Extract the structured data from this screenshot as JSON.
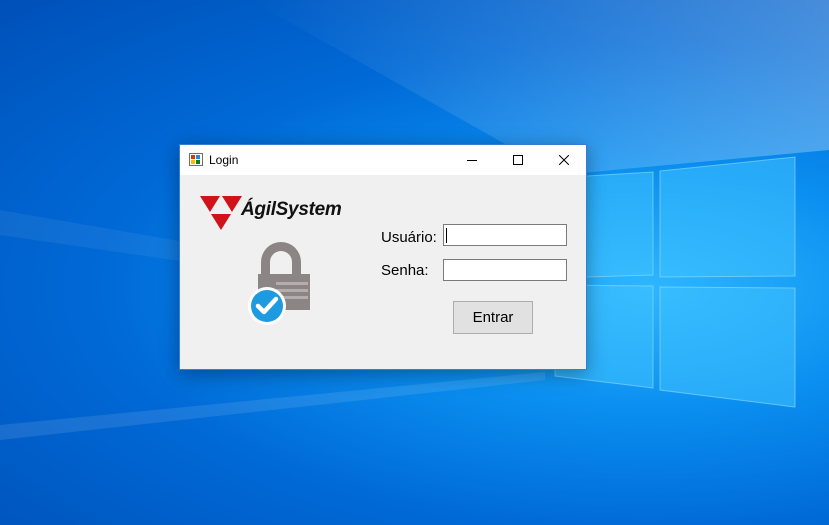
{
  "window": {
    "title": "Login",
    "controls": {
      "minimize_icon": "minimize-icon",
      "maximize_icon": "maximize-icon",
      "close_icon": "close-icon"
    }
  },
  "brand": {
    "name": "ÁgilSystem",
    "accent_color": "#d0121b"
  },
  "form": {
    "username_label": "Usuário:",
    "username_value": "",
    "password_label": "Senha:",
    "password_value": "",
    "submit_label": "Entrar"
  },
  "icons": {
    "app": "app-icon",
    "lock": "lock-icon",
    "check": "check-icon"
  },
  "colors": {
    "desktop_blue": "#0078d7",
    "window_bg": "#f0f0f0",
    "check_blue": "#1e9be0"
  }
}
